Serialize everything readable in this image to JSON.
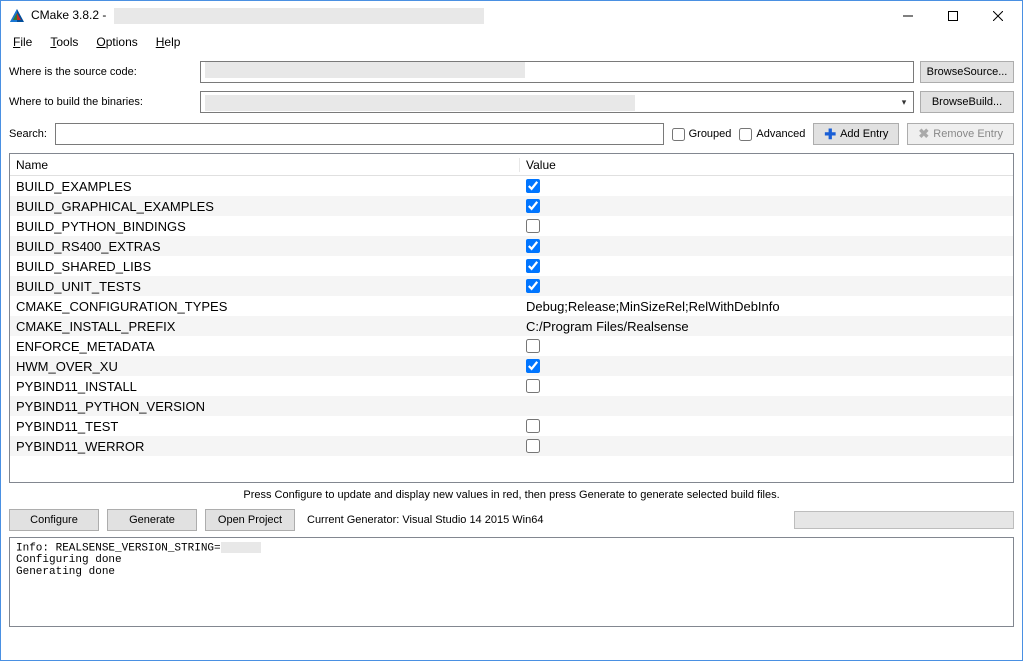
{
  "window": {
    "title_prefix": "CMake 3.8.2 - "
  },
  "menu": {
    "file": "File",
    "tools": "Tools",
    "options": "Options",
    "help": "Help"
  },
  "paths": {
    "source_label": "Where is the source code:",
    "binaries_label": "Where to build the binaries:",
    "browse_source": "Browse Source...",
    "browse_build": "Browse Build..."
  },
  "search": {
    "label": "Search:",
    "grouped": "Grouped",
    "advanced": "Advanced",
    "add_entry": "Add Entry",
    "remove_entry": "Remove Entry"
  },
  "table": {
    "header_name": "Name",
    "header_value": "Value",
    "rows": [
      {
        "name": "BUILD_EXAMPLES",
        "type": "check",
        "checked": true
      },
      {
        "name": "BUILD_GRAPHICAL_EXAMPLES",
        "type": "check",
        "checked": true
      },
      {
        "name": "BUILD_PYTHON_BINDINGS",
        "type": "check",
        "checked": false
      },
      {
        "name": "BUILD_RS400_EXTRAS",
        "type": "check",
        "checked": true
      },
      {
        "name": "BUILD_SHARED_LIBS",
        "type": "check",
        "checked": true
      },
      {
        "name": "BUILD_UNIT_TESTS",
        "type": "check",
        "checked": true
      },
      {
        "name": "CMAKE_CONFIGURATION_TYPES",
        "type": "text",
        "value": "Debug;Release;MinSizeRel;RelWithDebInfo"
      },
      {
        "name": "CMAKE_INSTALL_PREFIX",
        "type": "text",
        "value": "C:/Program Files/Realsense"
      },
      {
        "name": "ENFORCE_METADATA",
        "type": "check",
        "checked": false
      },
      {
        "name": "HWM_OVER_XU",
        "type": "check",
        "checked": true
      },
      {
        "name": "PYBIND11_INSTALL",
        "type": "check",
        "checked": false
      },
      {
        "name": "PYBIND11_PYTHON_VERSION",
        "type": "text",
        "value": ""
      },
      {
        "name": "PYBIND11_TEST",
        "type": "check",
        "checked": false
      },
      {
        "name": "PYBIND11_WERROR",
        "type": "check",
        "checked": false
      }
    ]
  },
  "hint": "Press Configure to update and display new values in red, then press Generate to generate selected build files.",
  "actions": {
    "configure": "Configure",
    "generate": "Generate",
    "open_project": "Open Project",
    "generator_label": "Current Generator: Visual Studio 14 2015 Win64"
  },
  "log": {
    "line1_prefix": "Info: REALSENSE_VERSION_STRING=",
    "line2": "Configuring done",
    "line3": "Generating done"
  }
}
